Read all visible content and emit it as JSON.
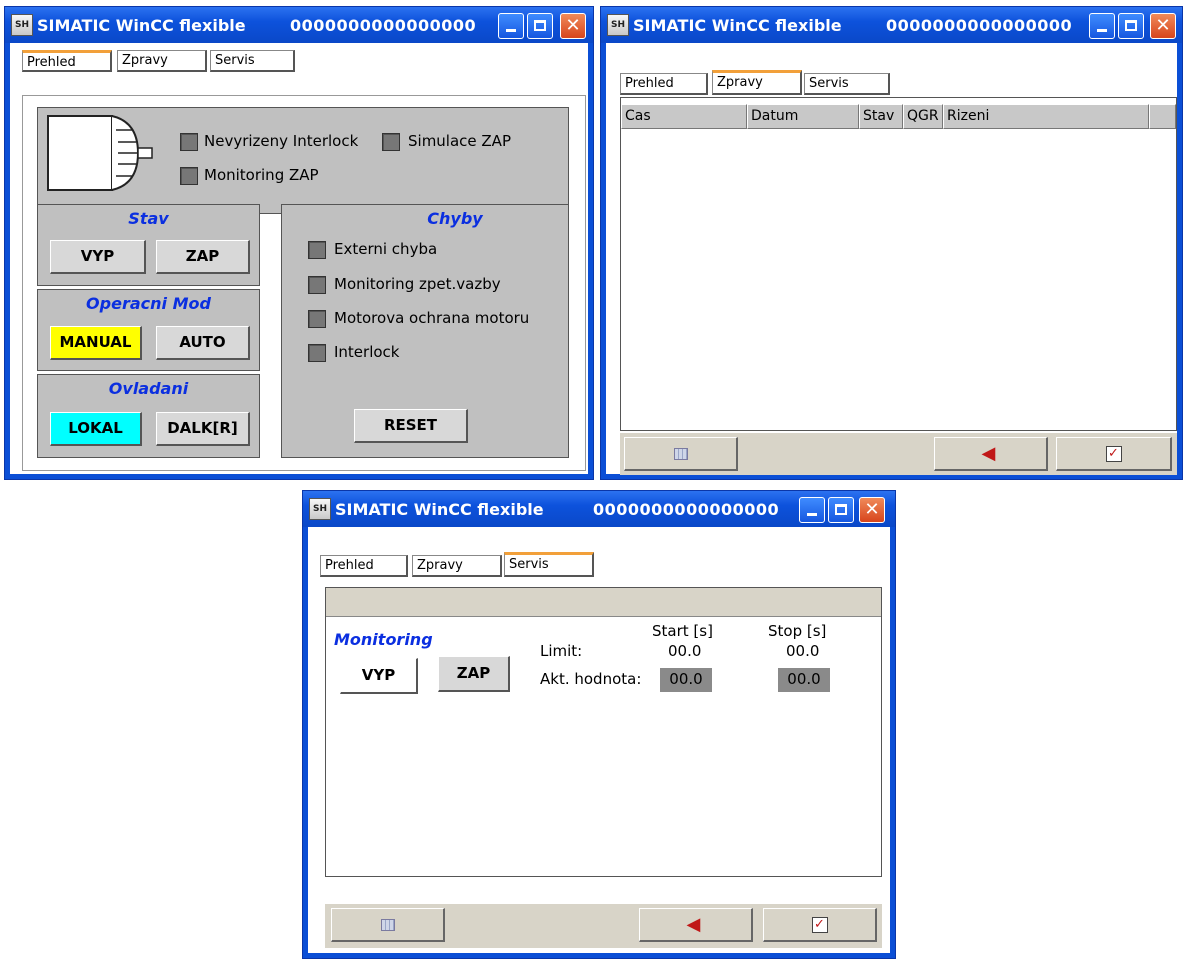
{
  "window": {
    "title": "SIMATIC WinCC flexible",
    "code": "0000000000000000",
    "icon_label": "SH"
  },
  "tabs": [
    "Prehled",
    "Zpravy",
    "Servis"
  ],
  "overview": {
    "indicators": {
      "interlock": "Nevyrizeny Interlock",
      "simulation": "Simulace ZAP",
      "monitoring": "Monitoring ZAP"
    },
    "stav": {
      "title": "Stav",
      "off": "VYP",
      "on": "ZAP"
    },
    "mode": {
      "title": "Operacni Mod",
      "manual": "MANUAL",
      "auto": "AUTO"
    },
    "control": {
      "title": "Ovladani",
      "local": "LOKAL",
      "remote": "DALK[R]"
    },
    "errors": {
      "title": "Chyby",
      "items": [
        "Externi chyba",
        "Monitoring zpet.vazby",
        "Motorova ochrana motoru",
        "Interlock"
      ],
      "reset": "RESET"
    },
    "colors": {
      "manual_active": "#ffff00",
      "local_active": "#00ffff",
      "group_title": "#0b2fe0"
    }
  },
  "messages": {
    "columns": [
      "Cas",
      "Datum",
      "Stav",
      "QGR",
      "Rizeni"
    ],
    "toolbar_icons": [
      "grid-icon",
      "acknowledge-icon",
      "checklist-icon"
    ]
  },
  "service": {
    "monitoring": {
      "title": "Monitoring",
      "off": "VYP",
      "on": "ZAP",
      "start_header": "Start [s]",
      "stop_header": "Stop [s]",
      "limit_label": "Limit:",
      "limit_start": "00.0",
      "limit_stop": "00.0",
      "actual_label": "Akt. hodnota:",
      "actual_start": "00.0",
      "actual_stop": "00.0"
    }
  }
}
